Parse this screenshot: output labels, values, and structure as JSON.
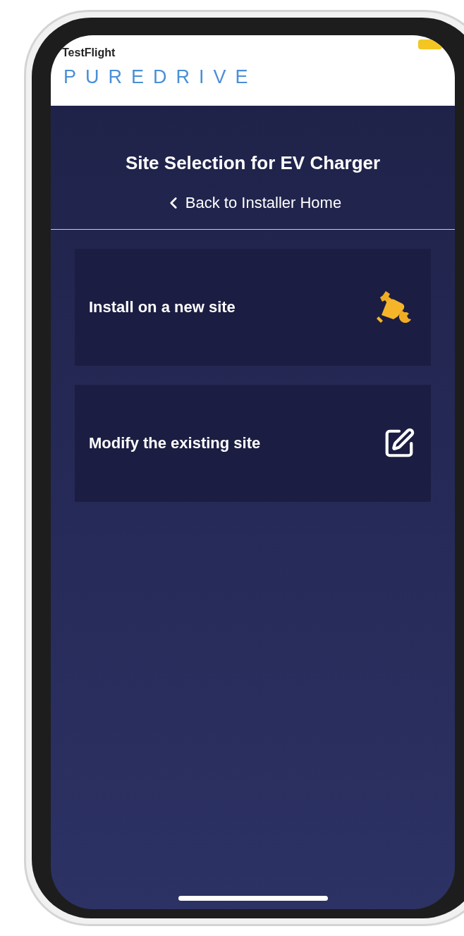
{
  "status_bar": {
    "back_app": "TestFlight"
  },
  "header": {
    "logo": "PUREDRIVE"
  },
  "page": {
    "title": "Site Selection for EV Charger",
    "back_link": "Back to Installer Home"
  },
  "options": [
    {
      "label": "Install on a new site",
      "kind": "install"
    },
    {
      "label": "Modify the existing site",
      "kind": "edit"
    }
  ]
}
